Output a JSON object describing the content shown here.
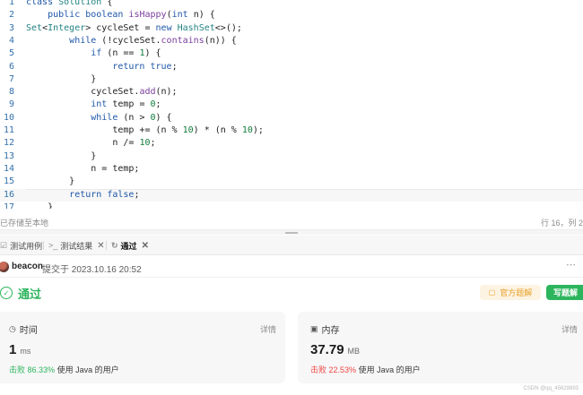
{
  "editor": {
    "lines": [
      {
        "no": "1",
        "tokens": [
          {
            "t": "class ",
            "c": "kw"
          },
          {
            "t": "Solution",
            "c": "cls"
          },
          {
            "t": " {",
            "c": "plain"
          }
        ]
      },
      {
        "no": "2",
        "tokens": [
          {
            "t": "    ",
            "c": "plain"
          },
          {
            "t": "public ",
            "c": "kw"
          },
          {
            "t": "boolean ",
            "c": "kw"
          },
          {
            "t": "isHappy",
            "c": "fn"
          },
          {
            "t": "(",
            "c": "plain"
          },
          {
            "t": "int ",
            "c": "kw"
          },
          {
            "t": "n) {",
            "c": "plain"
          }
        ]
      },
      {
        "no": "3",
        "tokens": [
          {
            "t": "Set",
            "c": "cls"
          },
          {
            "t": "<",
            "c": "plain"
          },
          {
            "t": "Integer",
            "c": "cls"
          },
          {
            "t": "> cycleSet = ",
            "c": "plain"
          },
          {
            "t": "new ",
            "c": "kw"
          },
          {
            "t": "HashSet",
            "c": "cls"
          },
          {
            "t": "<>();",
            "c": "plain"
          }
        ]
      },
      {
        "no": "4",
        "tokens": [
          {
            "t": "        ",
            "c": "plain"
          },
          {
            "t": "while ",
            "c": "kw"
          },
          {
            "t": "(!cycleSet.",
            "c": "plain"
          },
          {
            "t": "contains",
            "c": "fn"
          },
          {
            "t": "(n)) {",
            "c": "plain"
          }
        ]
      },
      {
        "no": "5",
        "tokens": [
          {
            "t": "            ",
            "c": "plain"
          },
          {
            "t": "if ",
            "c": "kw"
          },
          {
            "t": "(n == ",
            "c": "plain"
          },
          {
            "t": "1",
            "c": "num"
          },
          {
            "t": ") {",
            "c": "plain"
          }
        ]
      },
      {
        "no": "6",
        "tokens": [
          {
            "t": "                ",
            "c": "plain"
          },
          {
            "t": "return ",
            "c": "kw"
          },
          {
            "t": "true",
            "c": "kw"
          },
          {
            "t": ";",
            "c": "plain"
          }
        ]
      },
      {
        "no": "7",
        "tokens": [
          {
            "t": "            }",
            "c": "plain"
          }
        ]
      },
      {
        "no": "8",
        "tokens": [
          {
            "t": "            cycleSet.",
            "c": "plain"
          },
          {
            "t": "add",
            "c": "fn"
          },
          {
            "t": "(n);",
            "c": "plain"
          }
        ]
      },
      {
        "no": "9",
        "tokens": [
          {
            "t": "            ",
            "c": "plain"
          },
          {
            "t": "int ",
            "c": "kw"
          },
          {
            "t": "temp = ",
            "c": "plain"
          },
          {
            "t": "0",
            "c": "num"
          },
          {
            "t": ";",
            "c": "plain"
          }
        ]
      },
      {
        "no": "10",
        "tokens": [
          {
            "t": "            ",
            "c": "plain"
          },
          {
            "t": "while ",
            "c": "kw"
          },
          {
            "t": "(n > ",
            "c": "plain"
          },
          {
            "t": "0",
            "c": "num"
          },
          {
            "t": ") {",
            "c": "plain"
          }
        ]
      },
      {
        "no": "11",
        "tokens": [
          {
            "t": "                temp += (n % ",
            "c": "plain"
          },
          {
            "t": "10",
            "c": "num"
          },
          {
            "t": ") * (n % ",
            "c": "plain"
          },
          {
            "t": "10",
            "c": "num"
          },
          {
            "t": ");",
            "c": "plain"
          }
        ]
      },
      {
        "no": "12",
        "tokens": [
          {
            "t": "                n /= ",
            "c": "plain"
          },
          {
            "t": "10",
            "c": "num"
          },
          {
            "t": ";",
            "c": "plain"
          }
        ]
      },
      {
        "no": "13",
        "tokens": [
          {
            "t": "            }",
            "c": "plain"
          }
        ]
      },
      {
        "no": "14",
        "tokens": [
          {
            "t": "            n = temp;",
            "c": "plain"
          }
        ]
      },
      {
        "no": "15",
        "tokens": [
          {
            "t": "        }",
            "c": "plain"
          }
        ]
      },
      {
        "no": "16",
        "tokens": [
          {
            "t": "        ",
            "c": "plain"
          },
          {
            "t": "return ",
            "c": "kw"
          },
          {
            "t": "false",
            "c": "kw"
          },
          {
            "t": ";",
            "c": "plain"
          }
        ]
      },
      {
        "no": "17",
        "tokens": [
          {
            "t": "    }",
            "c": "plain"
          }
        ]
      }
    ],
    "active_line": "16"
  },
  "status": {
    "save": "已存储至本地",
    "cursor": "行 16，列 2"
  },
  "tabs": [
    {
      "label": "测试用例",
      "icon": "checkbox-icon",
      "closable": false
    },
    {
      "label": "测试结果",
      "icon": "terminal-icon",
      "closable": true
    },
    {
      "label": "通过",
      "icon": "refresh-icon",
      "closable": true,
      "active": true
    }
  ],
  "submission": {
    "user": "beacon",
    "submitted_at": "提交于 2023.10.16 20:52",
    "result": "通过",
    "official_solution": "官方题解",
    "write_solution": "写题解"
  },
  "stats": {
    "time": {
      "title": "时间",
      "detail": "详情",
      "value": "1",
      "unit": "ms",
      "beat_label": "击败",
      "beat_pct": "86.33%",
      "beat_suffix": "使用 Java 的用户"
    },
    "memory": {
      "title": "内存",
      "detail": "详情",
      "value": "37.79",
      "unit": "MB",
      "beat_label": "击败",
      "beat_pct": "22.53%",
      "beat_suffix": "使用 Java 的用户"
    }
  },
  "watermark": "CSDN @qq_45629893",
  "colors": {
    "accent_green": "#2db55d",
    "accent_orange": "#e8a02a",
    "accent_red": "#ef4743",
    "line_number": "#3371ab"
  }
}
